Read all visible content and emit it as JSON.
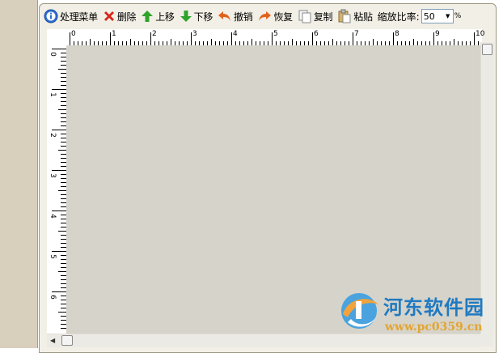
{
  "toolbar": {
    "menu_label": "处理菜单",
    "delete_label": "删除",
    "up_label": "上移",
    "down_label": "下移",
    "undo_label": "撤销",
    "redo_label": "恢复",
    "copy_label": "复制",
    "paste_label": "粘贴",
    "zoom_label": "缩放比率:",
    "zoom_value": "50",
    "zoom_unit": "%"
  },
  "ruler": {
    "top_numbers": [
      "0",
      "1",
      "2",
      "3",
      "4",
      "5",
      "6",
      "7",
      "8",
      "9",
      "10"
    ],
    "left_numbers": [
      "0",
      "1",
      "2",
      "3",
      "4",
      "5",
      "6",
      "7"
    ]
  },
  "watermark": {
    "title": "河东软件园",
    "url": "www.pc0359.cn"
  },
  "colors": {
    "canvas": "#d6d3ca",
    "panel": "#f2efe6",
    "watermark_blue": "#1f7ac2",
    "watermark_orange": "#e3a530"
  }
}
